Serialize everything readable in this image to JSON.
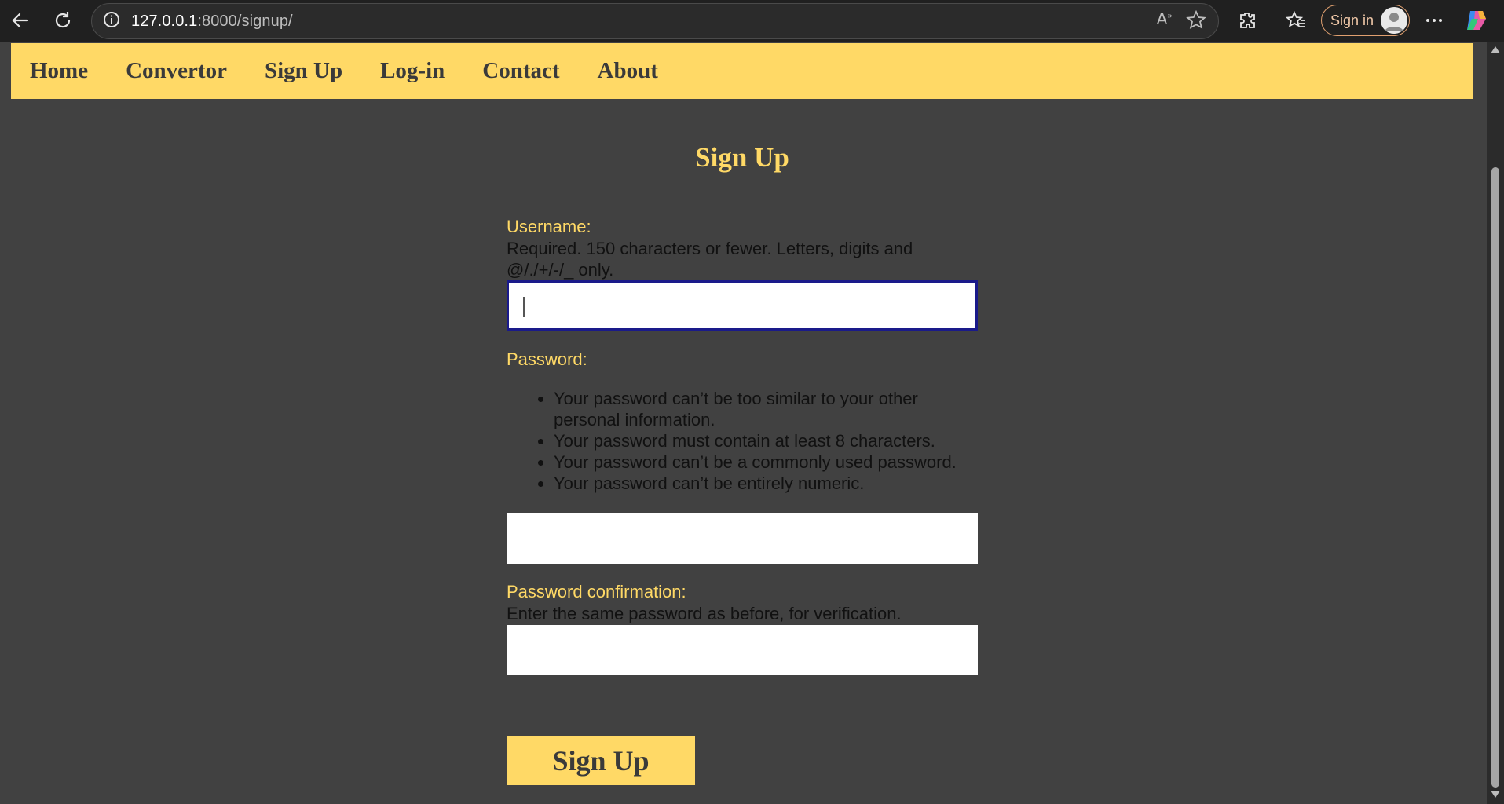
{
  "browser": {
    "url_host": "127.0.0.1",
    "url_rest": ":8000/signup/",
    "signin_label": "Sign in",
    "icons": [
      "back-icon",
      "reload-icon",
      "info-icon",
      "read-aloud-icon",
      "favorite-star-icon",
      "extensions-icon",
      "favorites-icon",
      "profile-icon",
      "more-icon",
      "copilot-icon"
    ]
  },
  "nav": {
    "items": [
      "Home",
      "Convertor",
      "Sign Up",
      "Log-in",
      "Contact",
      "About"
    ]
  },
  "form": {
    "title": "Sign Up",
    "username_label": "Username:",
    "username_help": "Required. 150 characters or fewer. Letters, digits and @/./+/-/_ only.",
    "username_value": "",
    "password_label": "Password:",
    "password_rules": [
      "Your password can’t be too similar to your other personal information.",
      "Your password must contain at least 8 characters.",
      "Your password can’t be a commonly used password.",
      "Your password can’t be entirely numeric."
    ],
    "password_value": "",
    "confirm_label": "Password confirmation:",
    "confirm_help": "Enter the same password as before, for verification.",
    "confirm_value": "",
    "submit_label": "Sign Up"
  },
  "colors": {
    "accent": "#ffd966",
    "page_bg": "#414141",
    "chrome_bg": "#202020"
  }
}
